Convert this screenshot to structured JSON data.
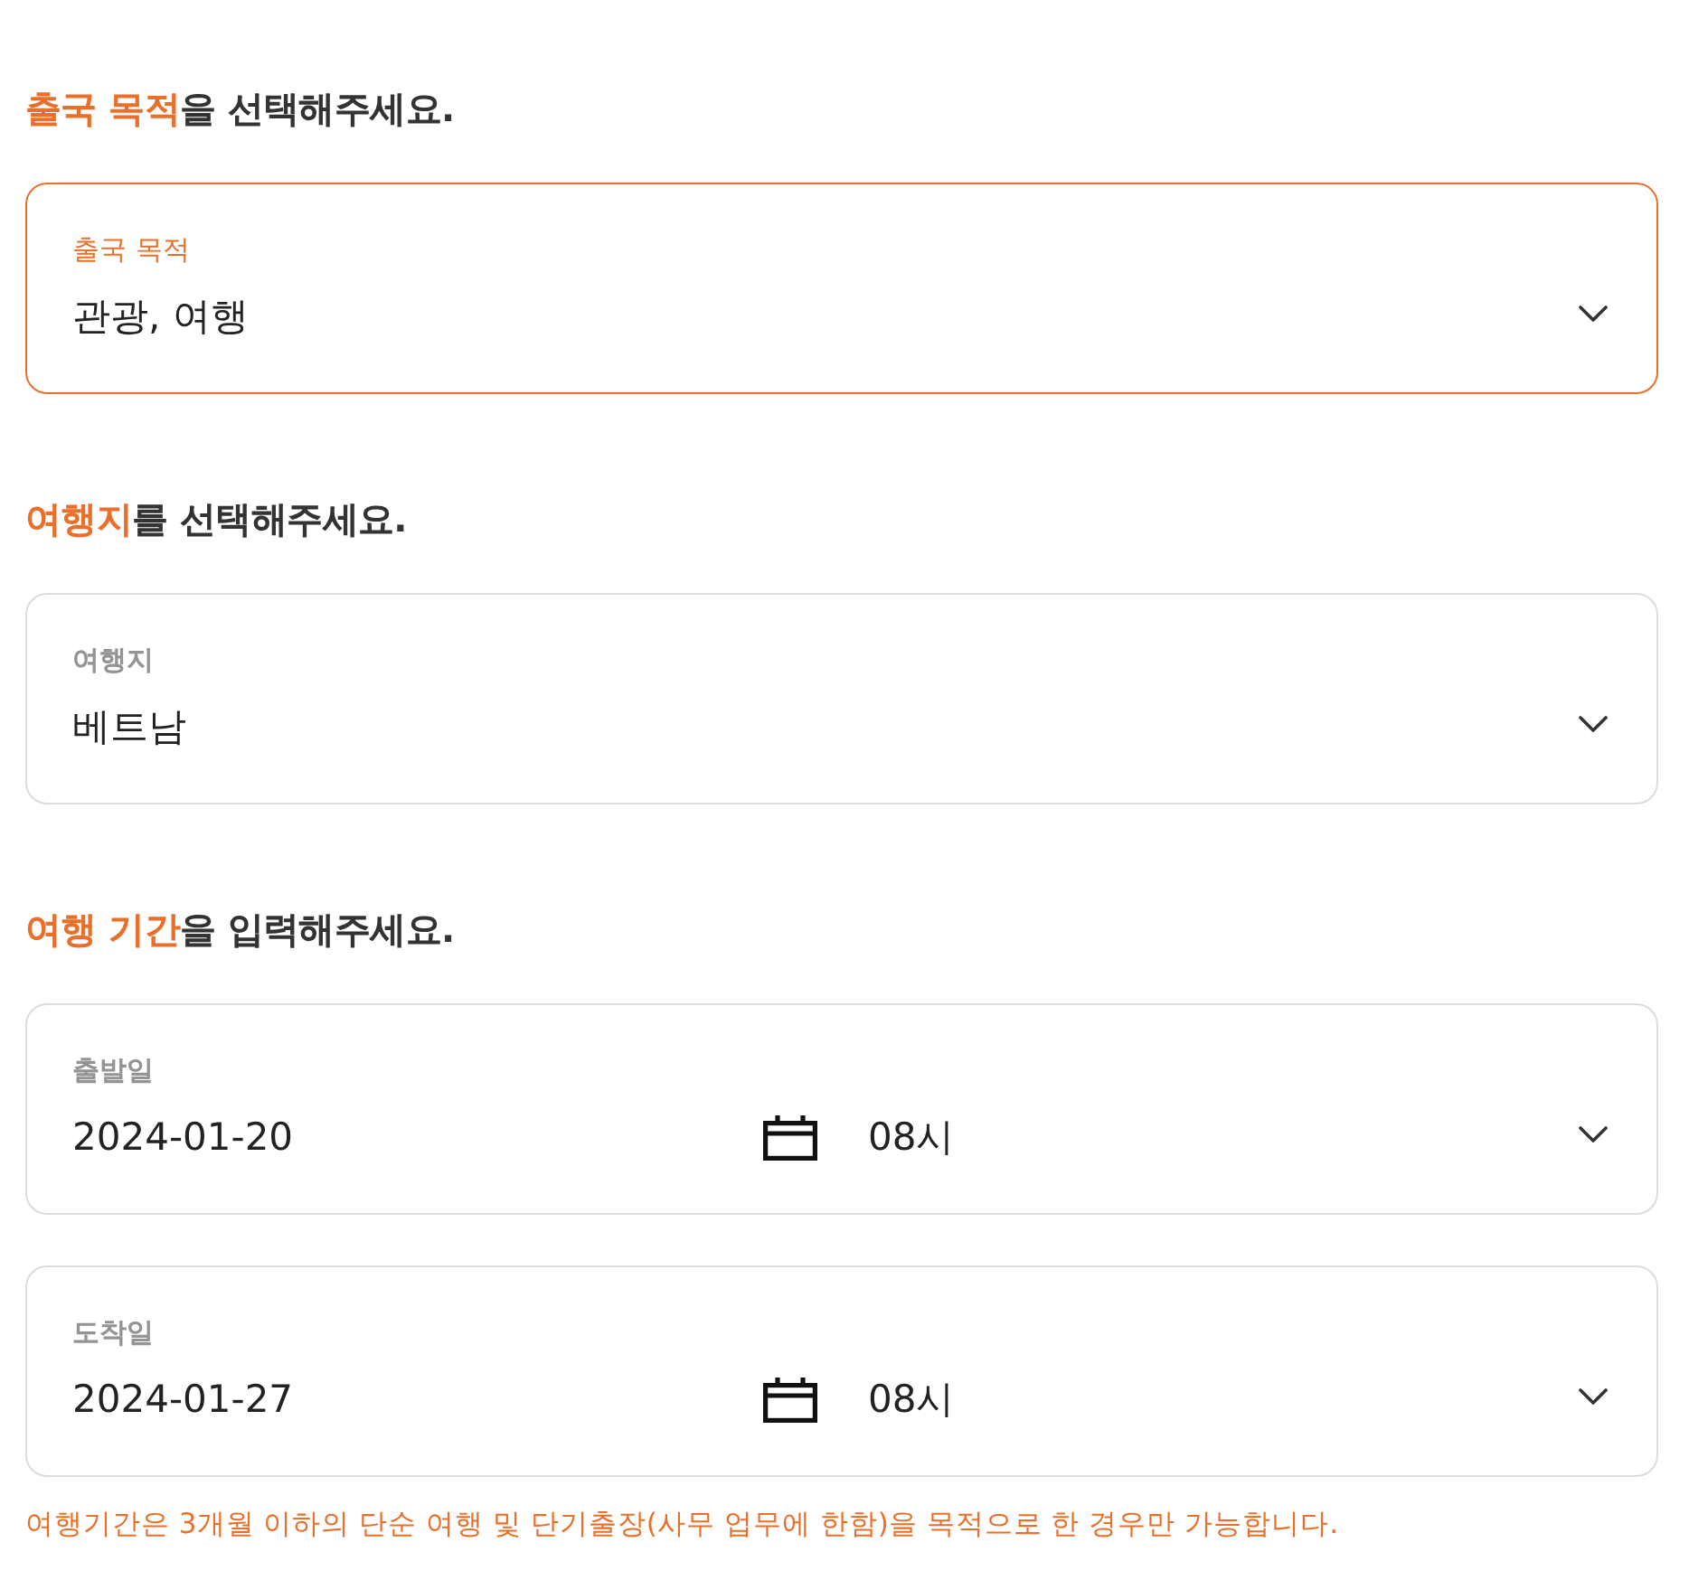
{
  "sections": [
    {
      "heading": {
        "highlight": "출국 목적",
        "rest": "을 선택해주세요."
      },
      "fields": [
        {
          "kind": "select",
          "label": "출국 목적",
          "value": "관광, 여행",
          "focused": true
        }
      ]
    },
    {
      "heading": {
        "highlight": "여행지",
        "rest": "를 선택해주세요."
      },
      "fields": [
        {
          "kind": "select",
          "label": "여행지",
          "value": "베트남",
          "focused": false
        }
      ]
    },
    {
      "heading": {
        "highlight": "여행 기간",
        "rest": "을 입력해주세요."
      },
      "fields": [
        {
          "kind": "datetime",
          "label": "출발일",
          "date": "2024-01-20",
          "hour": "08시",
          "focused": false
        },
        {
          "kind": "datetime",
          "label": "도착일",
          "date": "2024-01-27",
          "hour": "08시",
          "focused": false
        }
      ],
      "note": "여행기간은 3개월 이하의 단순 여행 및 단기출장(사무 업무에 한함)을 목적으로 한 경우만 가능합니다."
    }
  ]
}
